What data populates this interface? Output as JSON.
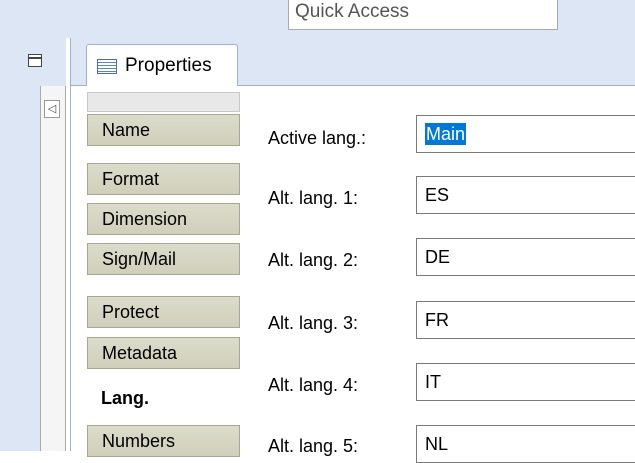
{
  "toolbar": {
    "quick_access_placeholder": "Quick Access"
  },
  "tabs": [
    {
      "label": "Properties",
      "icon": "properties-icon"
    }
  ],
  "nav": {
    "items": [
      {
        "label": "Name"
      },
      {
        "label": "Format"
      },
      {
        "label": "Dimension"
      },
      {
        "label": "Sign/Mail"
      },
      {
        "label": "Protect"
      },
      {
        "label": "Metadata"
      },
      {
        "label": "Lang.",
        "active": true
      },
      {
        "label": "Numbers"
      }
    ]
  },
  "form": {
    "fields": [
      {
        "label": "Active lang.:",
        "value": "Main",
        "selected": true
      },
      {
        "label": "Alt. lang. 1:",
        "value": "ES"
      },
      {
        "label": "Alt. lang. 2:",
        "value": "DE"
      },
      {
        "label": "Alt. lang. 3:",
        "value": "FR"
      },
      {
        "label": "Alt. lang. 4:",
        "value": "IT"
      },
      {
        "label": "Alt. lang. 5:",
        "value": "NL"
      }
    ]
  },
  "colors": {
    "chrome_bg": "#dce6f4",
    "nav_bg": "#cfcfba",
    "selection": "#0078d7"
  }
}
